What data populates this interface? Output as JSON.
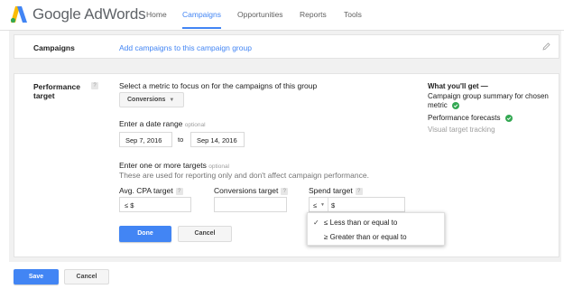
{
  "header": {
    "app_title": "Google AdWords",
    "nav": [
      "Home",
      "Campaigns",
      "Opportunities",
      "Reports",
      "Tools"
    ],
    "active_nav": "Campaigns"
  },
  "campaigns_card": {
    "label": "Campaigns",
    "link": "Add campaigns to this campaign group"
  },
  "performance": {
    "label": "Performance target",
    "help": "?",
    "metric_prompt": "Select a metric to focus on for the campaigns of this group",
    "metric_selected": "Conversions",
    "date_label": "Enter a date range",
    "date_optional": "optional",
    "date_start": "Sep 7, 2016",
    "date_to": "to",
    "date_end": "Sep 14, 2016",
    "targets_label": "Enter one or more targets",
    "targets_optional": "optional",
    "targets_note": "These are used for reporting only and don't affect campaign performance.",
    "avg_cpa_label": "Avg. CPA target",
    "avg_cpa_value": "≤ $",
    "conversions_label": "Conversions target",
    "conversions_value": "",
    "spend_label": "Spend target",
    "spend_operator": "≤",
    "spend_value": "$",
    "done_label": "Done",
    "cancel_label": "Cancel"
  },
  "what_you_get": {
    "title": "What you'll get —",
    "item1": "Campaign group summary for chosen metric",
    "item2": "Performance forecasts",
    "item3": "Visual target tracking"
  },
  "spend_menu": {
    "options": [
      "≤ Less than or equal to",
      "≥ Greater than or equal to"
    ],
    "selected_index": 0
  },
  "footer": {
    "save_label": "Save",
    "cancel_label": "Cancel"
  },
  "colors": {
    "accent": "#4285f4",
    "check": "#34a853"
  }
}
